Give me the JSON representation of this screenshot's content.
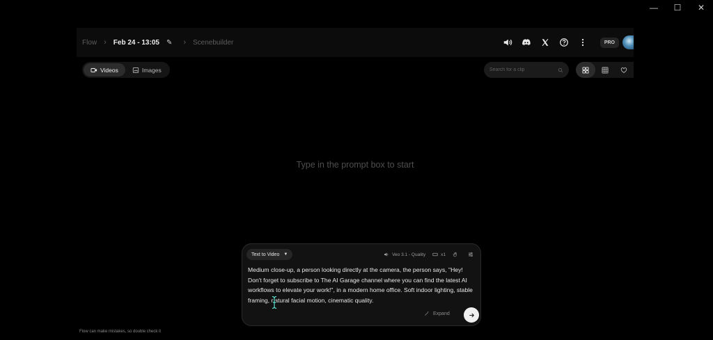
{
  "window_controls": {
    "minimize": "—",
    "maximize": "☐",
    "close": "✕"
  },
  "breadcrumb": {
    "root": "Flow",
    "project": "Feb 24 - 13:05",
    "page": "Scenebuilder"
  },
  "topbar": {
    "icons": [
      "speaker-icon",
      "discord-icon",
      "x-logo-icon",
      "help-icon",
      "more-icon"
    ],
    "plan_badge": "PRO"
  },
  "tabs": [
    {
      "label": "Videos",
      "icon": "video-icon",
      "active": true
    },
    {
      "label": "Images",
      "icon": "image-icon",
      "active": false
    }
  ],
  "search": {
    "placeholder": "Search for a clip"
  },
  "view_toggle": [
    "grid-large-icon",
    "grid-small-icon",
    "heart-icon"
  ],
  "empty_state": "Type in the prompt box to start",
  "prompt_box": {
    "mode": "Text to Video",
    "model": "Veo 3.1 - Quality",
    "count": "x1",
    "text": "Medium close-up, a person looking directly at the camera, the person says, \"Hey! Don't forget to subscribe to The AI Garage channel where you can find the latest AI workflows to elevate your work!\", in a modern home office. Soft indoor lighting, stable framing, natural facial motion, cinematic quality.",
    "expand_label": "Expand"
  },
  "footer_note": "Flow can make mistakes, so double check it",
  "colors": {
    "background": "#000000",
    "panel": "#121212",
    "send_button": "#efefef"
  }
}
